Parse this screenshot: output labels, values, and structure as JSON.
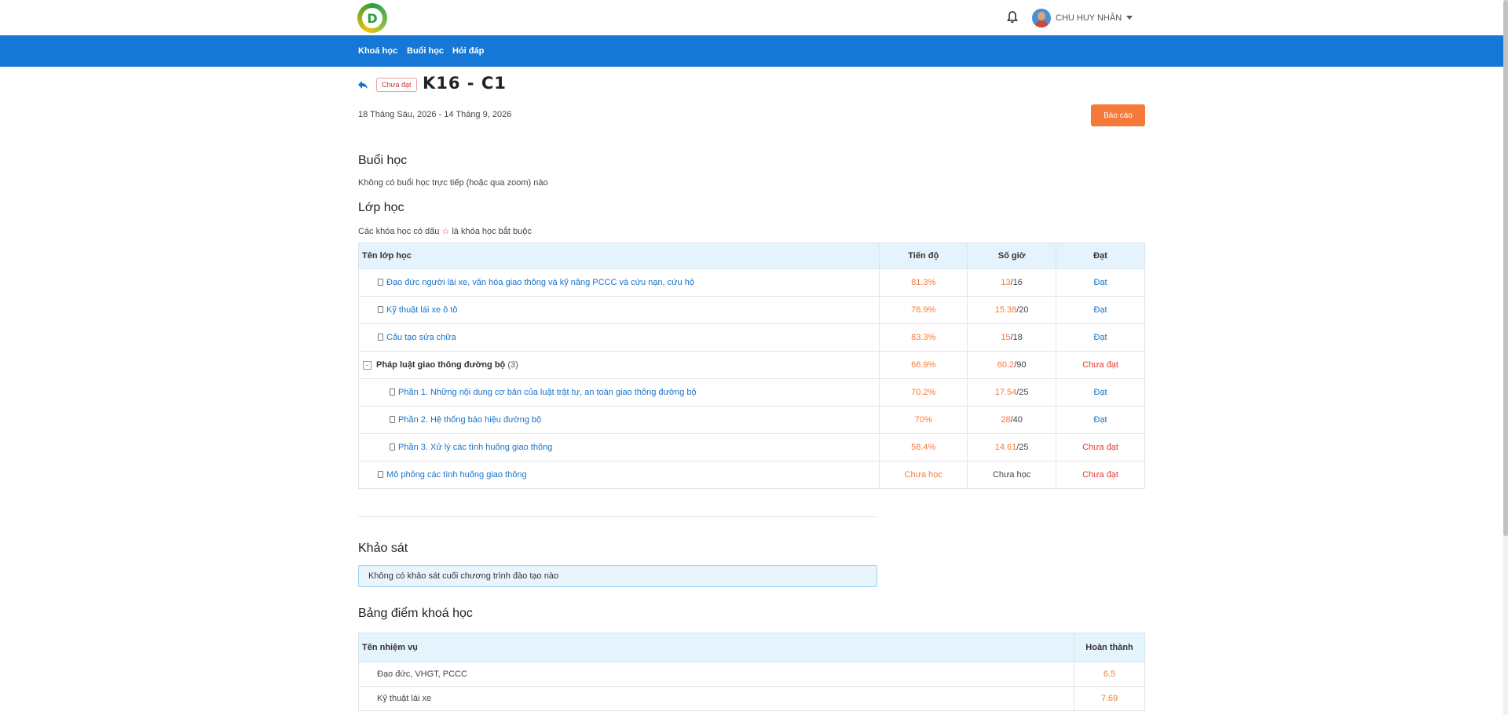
{
  "header": {
    "logo_text": "D",
    "user_name": "CHU HUY NHÂN"
  },
  "nav": {
    "items": [
      "Khoá học",
      "Buổi học",
      "Hỏi đáp"
    ]
  },
  "course": {
    "status": "Chưa đạt",
    "title": "K16 - C1",
    "date_range": "18 Tháng Sáu, 2026 - 14 Tháng 9, 2026",
    "report_button": "Báo cáo"
  },
  "sessions": {
    "title": "Buổi học",
    "empty_text": "Không có buổi học trực tiếp (hoặc qua zoom) nào"
  },
  "classes": {
    "title": "Lớp học",
    "note_before": "Các khóa học có dấu",
    "note_star": "☆",
    "note_after": "là khóa học bắt buộc",
    "columns": {
      "name": "Tên lớp học",
      "progress": "Tiến độ",
      "hours": "Số giờ",
      "result": "Đạt"
    },
    "rows": [
      {
        "name": "Đạo đức người lái xe, văn hóa giao thông và kỹ năng PCCC và cứu nạn, cứu hộ",
        "progress": "81.3%",
        "hours_done": "13",
        "hours_total": "/16",
        "result": "Đạt"
      },
      {
        "name": "Kỹ thuật lái xe ô tô",
        "progress": "76.9%",
        "hours_done": "15.38",
        "hours_total": "/20",
        "result": "Đạt"
      },
      {
        "name": "Cấu tạo sửa chữa",
        "progress": "83.3%",
        "hours_done": "15",
        "hours_total": "/18",
        "result": "Đạt"
      },
      {
        "name": "Pháp luật giao thông đường bộ",
        "count": "(3)",
        "toggle": "-",
        "progress": "66.9%",
        "hours_done": "60.2",
        "hours_total": "/90",
        "result": "Chưa đạt"
      },
      {
        "name": "Phần 1. Những nội dung cơ bản của luật trật tự, an toàn giao thông đường bộ",
        "progress": "70.2%",
        "hours_done": "17.54",
        "hours_total": "/25",
        "result": "Đạt"
      },
      {
        "name": "Phần 2. Hệ thống báo hiệu đường bộ",
        "progress": "70%",
        "hours_done": "28",
        "hours_total": "/40",
        "result": "Đạt"
      },
      {
        "name": "Phần 3. Xử lý các tình huống giao thông",
        "progress": "58.4%",
        "hours_done": "14.61",
        "hours_total": "/25",
        "result": "Chưa đạt"
      },
      {
        "name": "Mô phỏng các tình huống giao thông",
        "progress": "Chưa học",
        "hours_text": "Chưa học",
        "result": "Chưa đạt"
      }
    ]
  },
  "survey": {
    "title": "Khảo sát",
    "empty_text": "Không có khảo sát cuối chương trình đào tạo nào"
  },
  "scores": {
    "title": "Bảng điểm khoá học",
    "columns": {
      "name": "Tên nhiệm vụ",
      "done": "Hoàn thành"
    },
    "rows": [
      {
        "name": "Đạo đức, VHGT, PCCC",
        "value": "6.5"
      },
      {
        "name": "Kỹ thuật lái xe",
        "value": "7.69"
      }
    ]
  },
  "colors": {
    "nav_blue": "#1578d6",
    "accent_orange": "#f5793b",
    "fail_red": "#e53935",
    "link_blue": "#1a73c9"
  }
}
